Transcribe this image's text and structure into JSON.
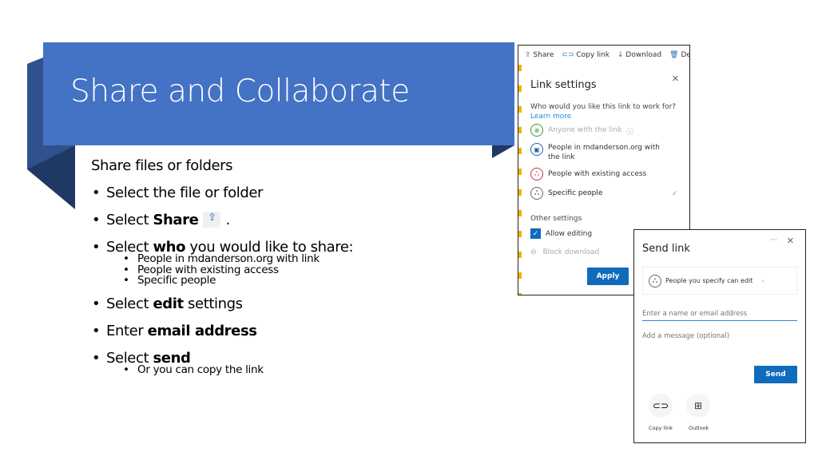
{
  "slide": {
    "title": "Share and Collaborate",
    "intro": "Share files or folders",
    "bullets": [
      {
        "pre": "Select the file or folder",
        "bold": "",
        "post": ""
      },
      {
        "pre": "Select ",
        "bold": "Share",
        "post": "."
      },
      {
        "pre": "Select ",
        "bold": "who",
        "post": " you would like to share:",
        "sub": [
          "People in mdanderson.org with link",
          "People with existing access",
          "Specific people"
        ]
      },
      {
        "pre": "Select ",
        "bold": "edit",
        "post": " settings"
      },
      {
        "pre": "Enter ",
        "bold": "email address",
        "post": ""
      },
      {
        "pre": "Select ",
        "bold": "send",
        "post": "",
        "sub": [
          "Or you can copy the link"
        ]
      }
    ],
    "colors": {
      "banner": "#4472c4",
      "ribbon_dark": "#2f528f",
      "ribbon_shadow": "#203864"
    }
  },
  "link_settings": {
    "toolbar": [
      {
        "icon": "share-icon",
        "label": "Share"
      },
      {
        "icon": "link-icon",
        "label": "Copy link"
      },
      {
        "icon": "download-icon",
        "label": "Download"
      },
      {
        "icon": "delete-icon",
        "label": "De"
      }
    ],
    "title": "Link settings",
    "question": "Who would you like this link to work for?",
    "learn_more": "Learn more",
    "options": [
      {
        "label": "Anyone with the link",
        "icon": "globe-icon",
        "color": "#3a9a3a",
        "disabled": true
      },
      {
        "label": "People in mdanderson.org with the link",
        "icon": "building-icon",
        "color": "#2b5fa8"
      },
      {
        "label": "People with existing access",
        "icon": "people-icon",
        "color": "#c4314b"
      },
      {
        "label": "Specific people",
        "icon": "people-icon",
        "color": "#555",
        "selected": true
      }
    ],
    "other_settings": "Other settings",
    "allow_editing": "Allow editing",
    "allow_editing_checked": true,
    "block_download": "Block download",
    "apply": "Apply"
  },
  "send_link": {
    "title": "Send link",
    "more": "···",
    "permission": "People you specify can edit",
    "email_placeholder": "Enter a name or email address",
    "message_placeholder": "Add a message (optional)",
    "send": "Send",
    "copy_link": "Copy link",
    "outlook": "Outlook",
    "accent": "#0f6cbd"
  }
}
